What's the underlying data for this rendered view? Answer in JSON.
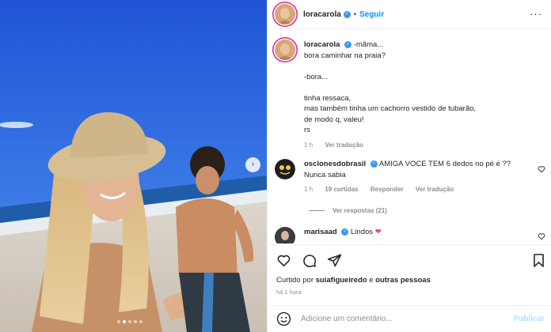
{
  "post": {
    "username": "loracarola",
    "follow_label": "Seguir",
    "separator": "•",
    "more_icon": "more-horizontal-icon",
    "photo_alt": ""
  },
  "caption": {
    "username": "loracarola",
    "lines": [
      "-mãma...",
      "bora caminhar na praia?",
      "",
      "-bora...",
      "",
      "tinha ressaca,",
      "mas também tinha um cachorro vestido de tubarão,",
      "de modo q, valeu!",
      "rs"
    ],
    "time": "1 h",
    "translate_label": "Ver tradução"
  },
  "comments": [
    {
      "username": "osclonesdobrasil",
      "text": "AMIGA VOCE TEM 6 dedos no pé é ??",
      "text2": "Nunca sabia",
      "time": "1 h",
      "likes": "19 curtidas",
      "reply_label": "Responder",
      "translate_label": "Ver tradução",
      "view_replies": "Ver respostas (21)"
    },
    {
      "username": "marisaad",
      "text": "Lindos",
      "emoji": "❤"
    }
  ],
  "actions": {
    "liked_prefix": "Curtido por",
    "liked_user": "suiafigueiredo",
    "liked_suffix": "e",
    "liked_others": "outras pessoas",
    "time_ago": "há 1 hora"
  },
  "comment_box": {
    "placeholder": "Adicione um comentário...",
    "publish_label": "Publicar"
  },
  "carousel": {
    "total": 5,
    "active_index": 1
  },
  "colors": {
    "accent": "#0095f6",
    "verified": "#3897f0",
    "like_red": "#ed4956",
    "muted": "#8e8e8e"
  }
}
